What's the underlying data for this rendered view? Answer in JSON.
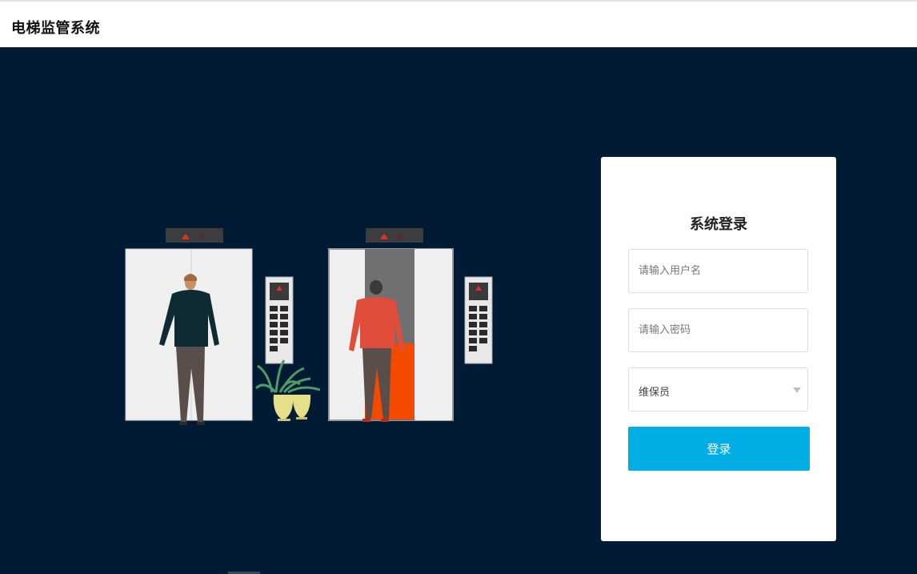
{
  "app": {
    "title": "电梯监管系统"
  },
  "login": {
    "title": "系统登录",
    "username_placeholder": "请输入用户名",
    "password_placeholder": "请输入密码",
    "role_selected": "维保员",
    "submit_label": "登录"
  },
  "colors": {
    "header_bg": "#ffffff",
    "page_bg": "#001b33",
    "accent": "#00aee6",
    "card_bg": "#ffffff"
  },
  "illustration": {
    "description_icons": [
      "elevator-icon",
      "person-icon",
      "plant-icon",
      "elevator-button-panel-icon"
    ]
  }
}
